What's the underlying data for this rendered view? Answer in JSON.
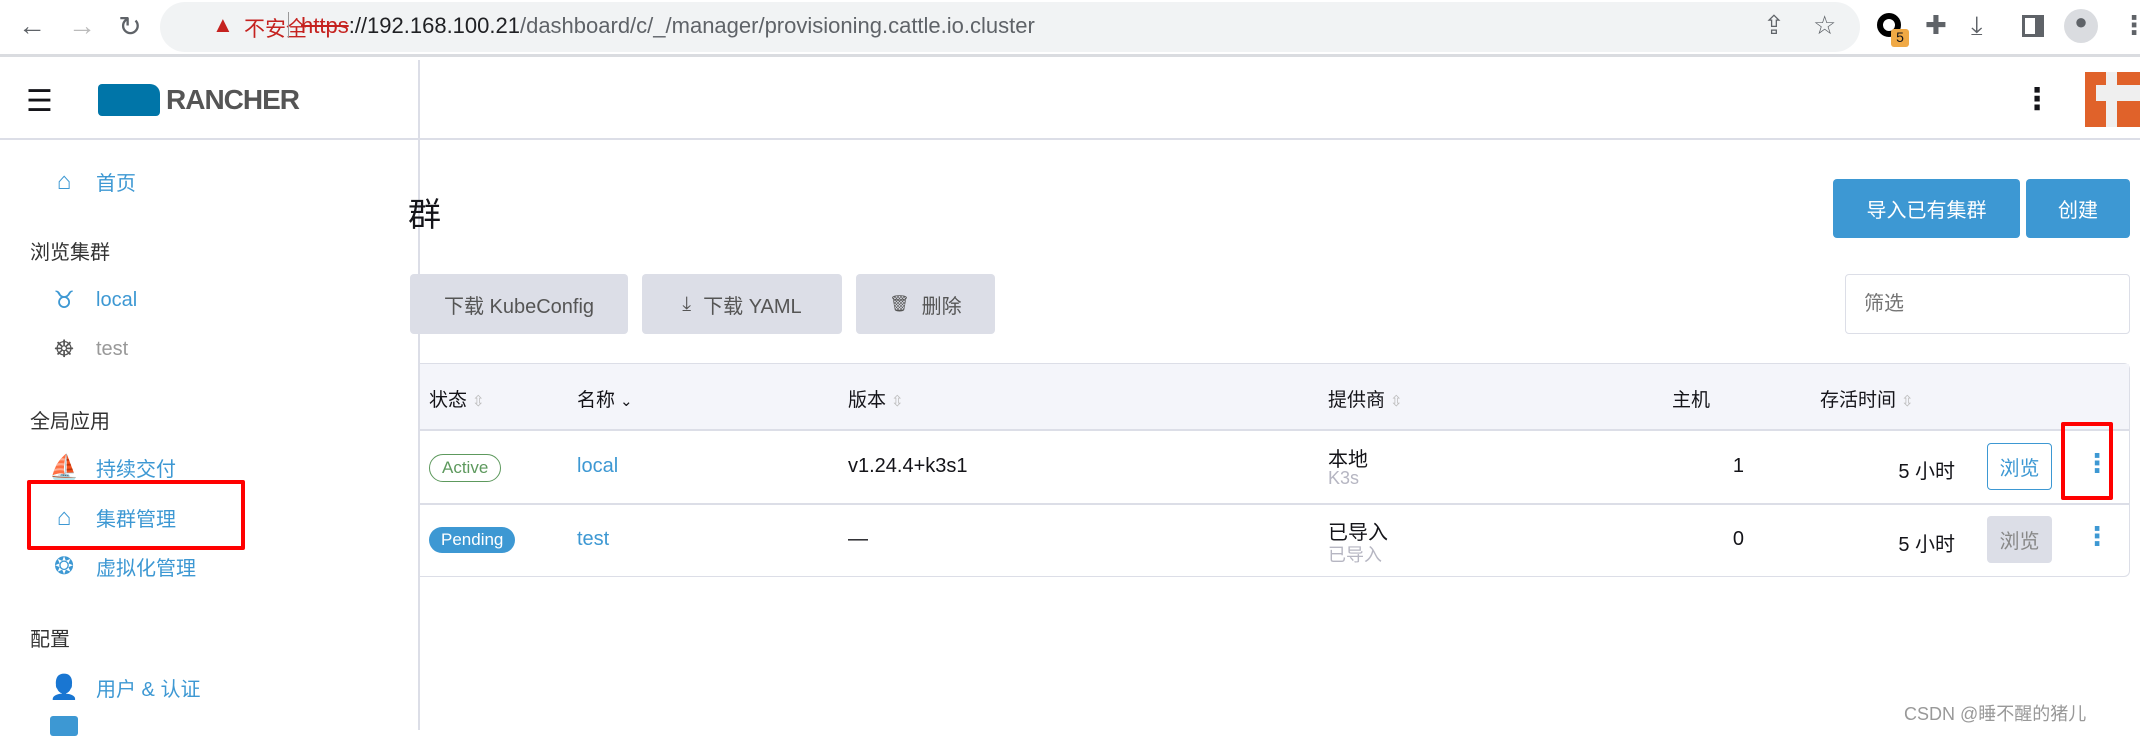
{
  "browser": {
    "security_label": "不安全",
    "url_scheme": "https",
    "url_host": "://192.168.100.21",
    "url_path": "/dashboard/c/_/manager/provisioning.cattle.io.cluster",
    "extension_badge": "5"
  },
  "header": {
    "logo_text": "RANCHER"
  },
  "sidebar": {
    "home": "首页",
    "explore_title": "浏览集群",
    "clusters": [
      {
        "label": "local"
      },
      {
        "label": "test"
      }
    ],
    "global_title": "全局应用",
    "global_items": [
      {
        "label": "持续交付"
      },
      {
        "label": "集群管理"
      },
      {
        "label": "虚拟化管理"
      }
    ],
    "config_title": "配置",
    "config_items": [
      {
        "label": "用户 & 认证"
      }
    ]
  },
  "main": {
    "title": "群",
    "import_button": "导入已有集群",
    "create_button": "创建",
    "download_kubeconfig": "下载 KubeConfig",
    "download_yaml": "下载 YAML",
    "delete": "删除",
    "filter_placeholder": "筛选",
    "columns": [
      "状态",
      "名称",
      "版本",
      "提供商",
      "主机",
      "存活时间"
    ],
    "rows": [
      {
        "state": "Active",
        "name": "local",
        "version": "v1.24.4+k3s1",
        "provider": "本地",
        "provider_sub": "K3s",
        "hosts": "1",
        "age": "5 小时",
        "explore": "浏览"
      },
      {
        "state": "Pending",
        "name": "test",
        "version": "—",
        "provider": "已导入",
        "provider_sub": "已导入",
        "hosts": "0",
        "age": "5 小时",
        "explore": "浏览"
      }
    ]
  },
  "watermark": "CSDN @睡不醒的猪儿",
  "colors": {
    "accent": "#3d98d3",
    "active": "#5d995d",
    "highlight": "#ff0000",
    "rancher_orange": "#e0622a"
  }
}
